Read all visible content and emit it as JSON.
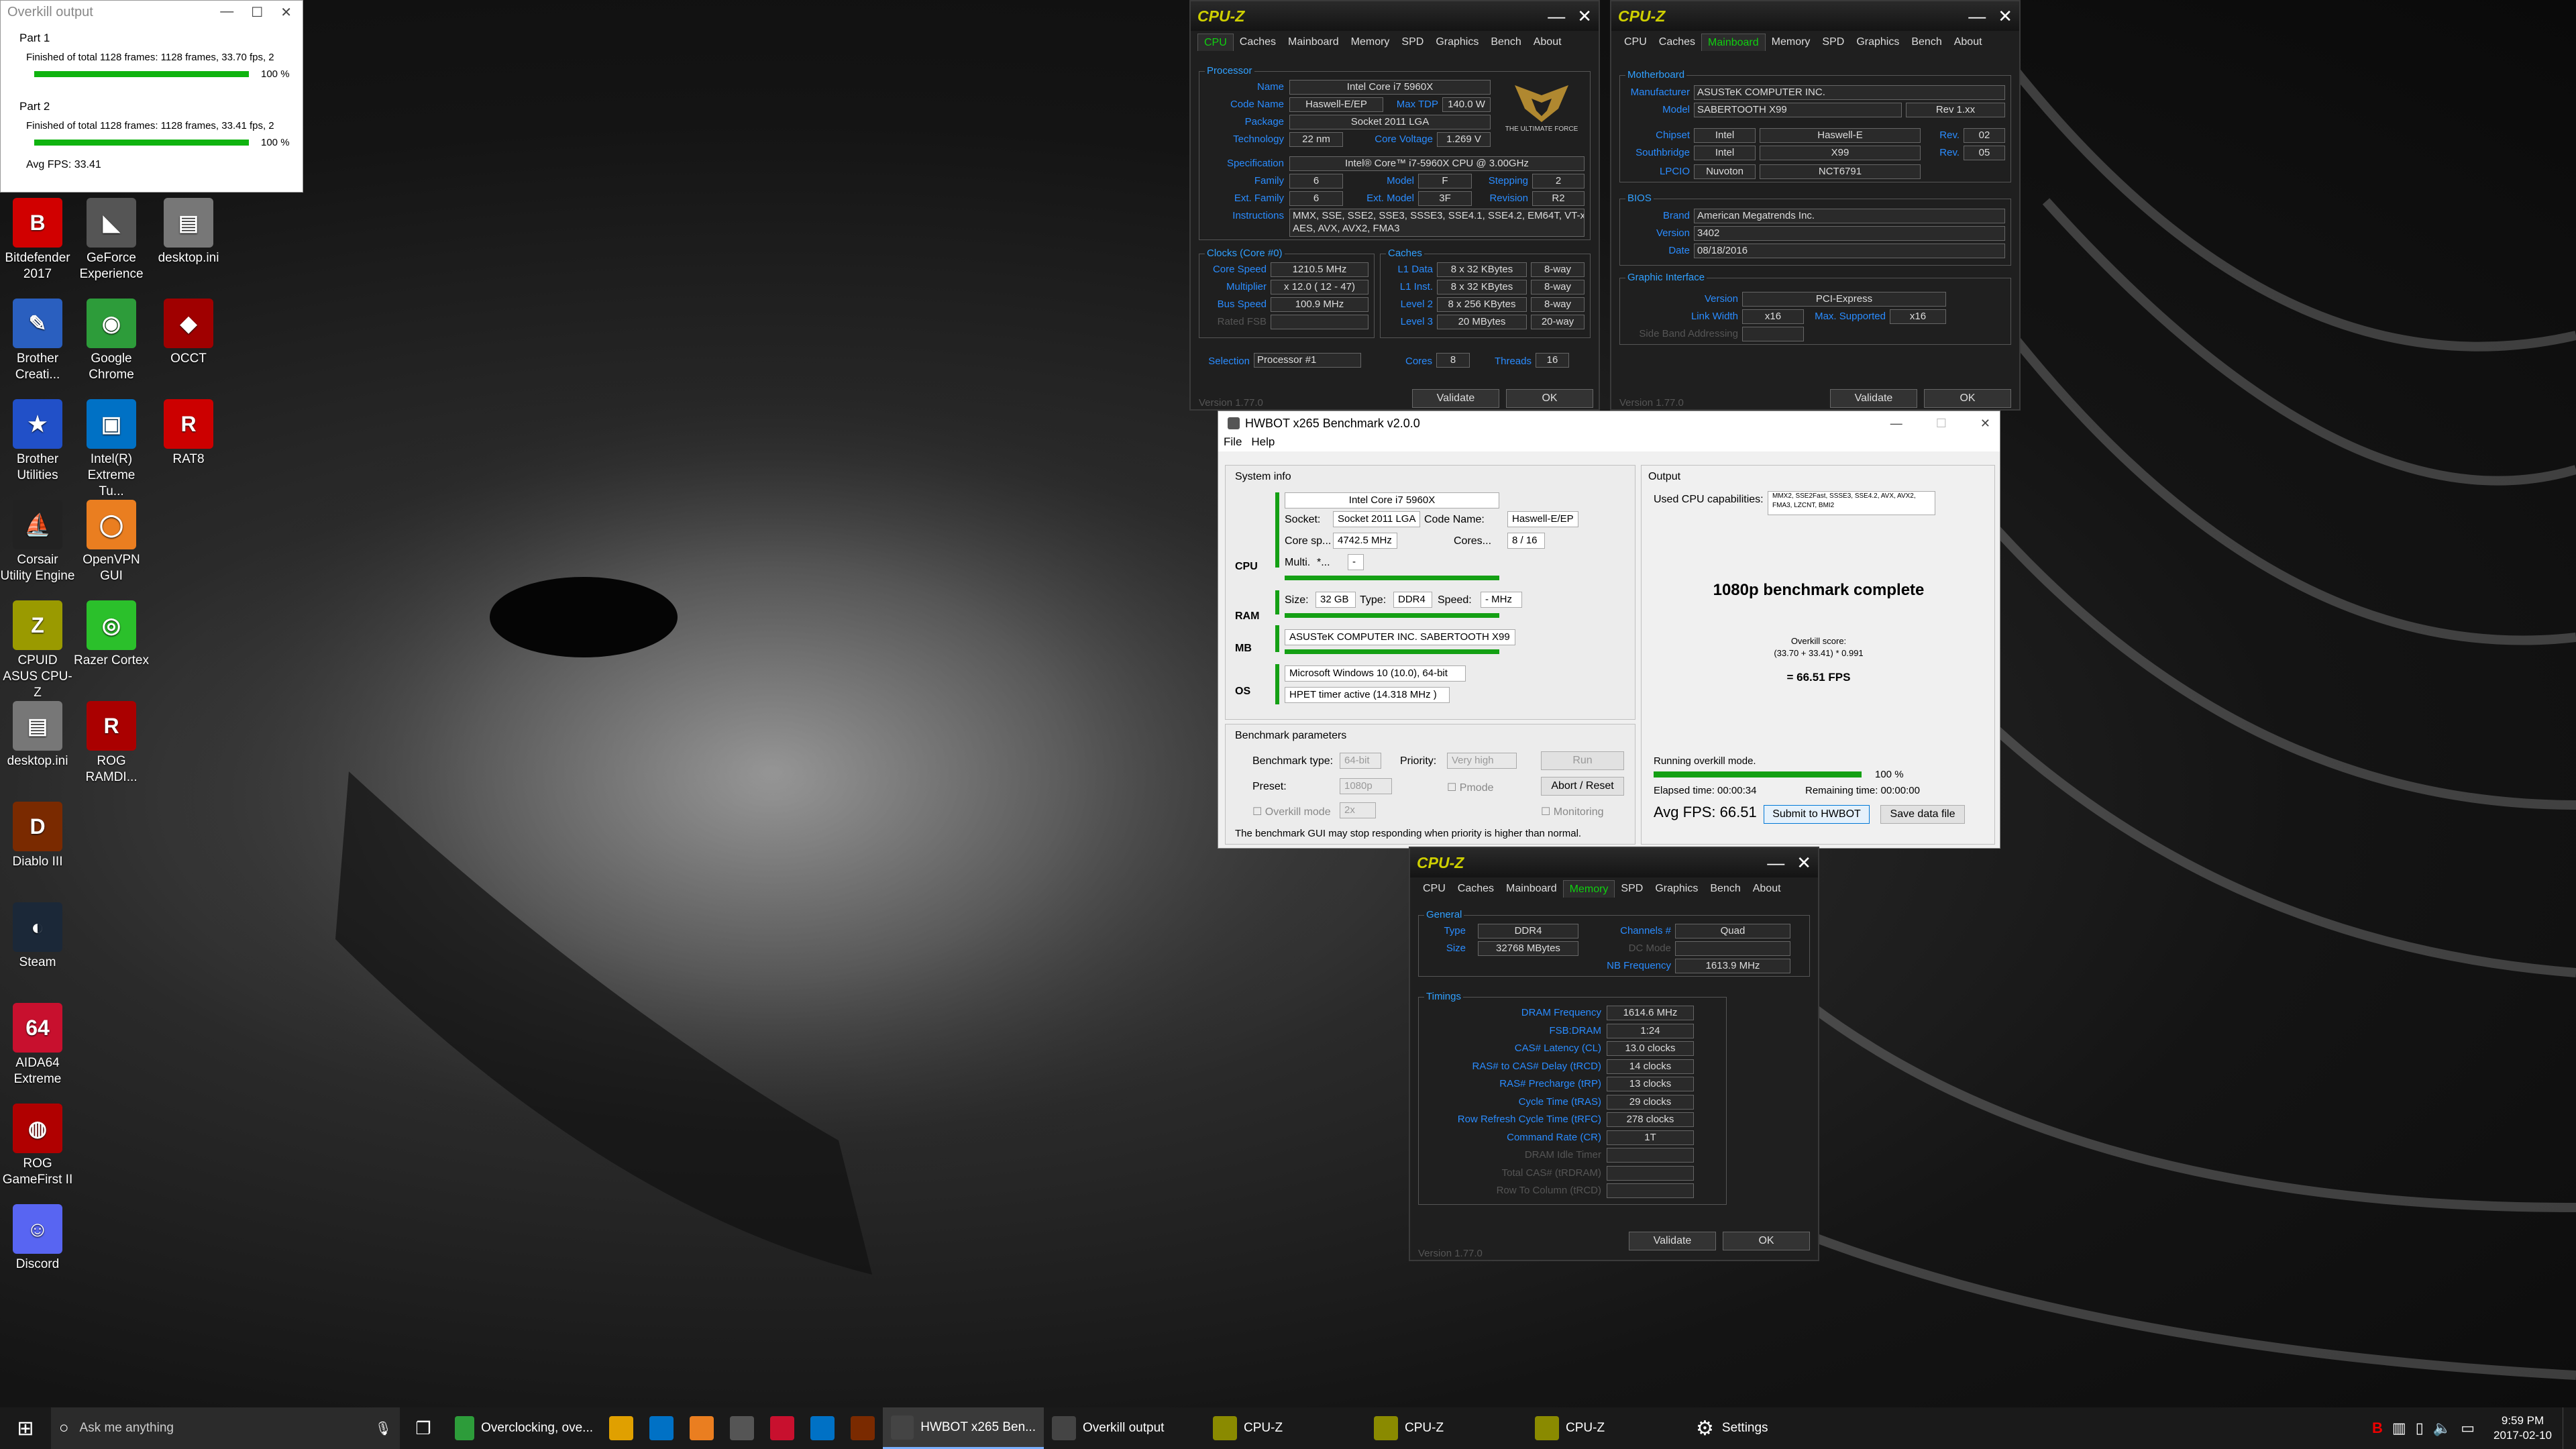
{
  "desktop_icons": [
    {
      "label": "Bitdefender 2017",
      "glyph": "B",
      "color": "#d10000"
    },
    {
      "label": "GeForce Experience",
      "glyph": "◣",
      "color": "#555"
    },
    {
      "label": "desktop.ini",
      "glyph": "▤",
      "color": "#777"
    },
    {
      "label": "Brother Creati...",
      "glyph": "✎",
      "color": "#2a5fbf"
    },
    {
      "label": "Google Chrome",
      "glyph": "◉",
      "color": "#2d9c3a"
    },
    {
      "label": "OCCT",
      "glyph": "◆",
      "color": "#a00000"
    },
    {
      "label": "Brother Utilities",
      "glyph": "★",
      "color": "#2150c8"
    },
    {
      "label": "Intel(R) Extreme Tu...",
      "glyph": "▣",
      "color": "#0071c5"
    },
    {
      "label": "RAT8",
      "glyph": "R",
      "color": "#c00"
    },
    {
      "label": "Corsair Utility Engine",
      "glyph": "⛵",
      "color": "#222"
    },
    {
      "label": "OpenVPN GUI",
      "glyph": "◯",
      "color": "#ea7e20"
    },
    {
      "label": "CPUID ASUS CPU-Z",
      "glyph": "Z",
      "color": "#9a9a00"
    },
    {
      "label": "Razer Cortex",
      "glyph": "◎",
      "color": "#2bc02b"
    },
    {
      "label": "desktop.ini",
      "glyph": "▤",
      "color": "#777"
    },
    {
      "label": "ROG RAMDI...",
      "glyph": "R",
      "color": "#aa0000"
    },
    {
      "label": "Diablo III",
      "glyph": "D",
      "color": "#7a2a00"
    },
    {
      "label": "Steam",
      "glyph": "◐",
      "color": "#1b2838"
    },
    {
      "label": "AIDA64 Extreme",
      "glyph": "64",
      "color": "#c8102e"
    },
    {
      "label": "ROG GameFirst II",
      "glyph": "◍",
      "color": "#b00000"
    },
    {
      "label": "Discord",
      "glyph": "☺",
      "color": "#5865f2"
    }
  ],
  "overkill": {
    "title": "Overkill output",
    "part1_label": "Part 1",
    "part1_text": "Finished of total 1128 frames: 1128 frames, 33.70 fps,  2",
    "part1_pct": "100 %",
    "part1_progress": 1.0,
    "part2_label": "Part 2",
    "part2_text": "Finished of total 1128 frames: 1128 frames, 33.41 fps,  2",
    "part2_pct": "100 %",
    "part2_progress": 1.0,
    "avg": "Avg FPS: 33.41"
  },
  "cpuz_cpu": {
    "title": "CPU-Z",
    "tabs": [
      "CPU",
      "Caches",
      "Mainboard",
      "Memory",
      "SPD",
      "Graphics",
      "Bench",
      "About"
    ],
    "processor_group": "Processor",
    "name_l": "Name",
    "name": "Intel Core i7 5960X",
    "code_l": "Code Name",
    "code": "Haswell-E/EP",
    "tdp_l": "Max TDP",
    "tdp": "140.0 W",
    "pkg_l": "Package",
    "pkg": "Socket 2011 LGA",
    "tech_l": "Technology",
    "tech": "22 nm",
    "volt_l": "Core Voltage",
    "volt": "1.269 V",
    "spec_l": "Specification",
    "spec": "Intel® Core™ i7-5960X CPU @ 3.00GHz",
    "fam_l": "Family",
    "fam": "6",
    "model_l": "Model",
    "model": "F",
    "step_l": "Stepping",
    "step": "2",
    "extfam_l": "Ext. Family",
    "extfam": "6",
    "extmod_l": "Ext. Model",
    "extmod": "3F",
    "rev_l": "Revision",
    "rev": "R2",
    "instr_l": "Instructions",
    "instr1": "MMX, SSE, SSE2, SSE3, SSSE3, SSE4.1, SSE4.2, EM64T, VT-x,",
    "instr2": "AES, AVX, AVX2, FMA3",
    "logo1": "THE ULTIMATE FORCE",
    "clocks_group": "Clocks (Core #0)",
    "caches_group": "Caches",
    "cs_l": "Core Speed",
    "cs": "1210.5 MHz",
    "mul_l": "Multiplier",
    "mul": "x 12.0 ( 12 - 47)",
    "bus_l": "Bus Speed",
    "bus": "100.9 MHz",
    "fsb_l": "Rated FSB",
    "l1d_l": "L1 Data",
    "l1d": "8 x 32 KBytes",
    "l1d_w": "8-way",
    "l1i_l": "L1 Inst.",
    "l1i": "8 x 32 KBytes",
    "l1i_w": "8-way",
    "l2_l": "Level 2",
    "l2": "8 x 256 KBytes",
    "l2_w": "8-way",
    "l3_l": "Level 3",
    "l3": "20 MBytes",
    "l3_w": "20-way",
    "sel_l": "Selection",
    "sel": "Processor #1",
    "cores_l": "Cores",
    "cores": "8",
    "threads_l": "Threads",
    "threads": "16",
    "validate": "Validate",
    "ok": "OK",
    "version": "Version 1.77.0"
  },
  "cpuz_mb": {
    "title": "CPU-Z",
    "tabs": [
      "CPU",
      "Caches",
      "Mainboard",
      "Memory",
      "SPD",
      "Graphics",
      "Bench",
      "About"
    ],
    "mb_group": "Motherboard",
    "manu_l": "Manufacturer",
    "manu": "ASUSTeK COMPUTER INC.",
    "model_l": "Model",
    "model": "SABERTOOTH X99",
    "model_rev": "Rev 1.xx",
    "chip_l": "Chipset",
    "chip_v": "Intel",
    "chip_n": "Haswell-E",
    "chip_rl": "Rev.",
    "chip_r": "02",
    "sb_l": "Southbridge",
    "sb_v": "Intel",
    "sb_n": "X99",
    "sb_rl": "Rev.",
    "sb_r": "05",
    "lpc_l": "LPCIO",
    "lpc_v": "Nuvoton",
    "lpc_n": "NCT6791",
    "bios_group": "BIOS",
    "brand_l": "Brand",
    "brand": "American Megatrends Inc.",
    "ver_l": "Version",
    "ver": "3402",
    "date_l": "Date",
    "date": "08/18/2016",
    "gi_group": "Graphic Interface",
    "giv_l": "Version",
    "giv": "PCI-Express",
    "lw_l": "Link Width",
    "lw": "x16",
    "ms_l": "Max. Supported",
    "ms": "x16",
    "sba_l": "Side Band Addressing",
    "validate": "Validate",
    "ok": "OK",
    "version": "Version 1.77.0"
  },
  "cpuz_mem": {
    "title": "CPU-Z",
    "tabs": [
      "CPU",
      "Caches",
      "Mainboard",
      "Memory",
      "SPD",
      "Graphics",
      "Bench",
      "About"
    ],
    "gen_group": "General",
    "type_l": "Type",
    "type": "DDR4",
    "ch_l": "Channels #",
    "ch": "Quad",
    "size_l": "Size",
    "size": "32768 MBytes",
    "dc_l": "DC Mode",
    "nb_l": "NB Frequency",
    "nb": "1613.9 MHz",
    "tim_group": "Timings",
    "rows": [
      {
        "l": "DRAM Frequency",
        "v": "1614.6 MHz"
      },
      {
        "l": "FSB:DRAM",
        "v": "1:24"
      },
      {
        "l": "CAS# Latency (CL)",
        "v": "13.0 clocks"
      },
      {
        "l": "RAS# to CAS# Delay (tRCD)",
        "v": "14 clocks"
      },
      {
        "l": "RAS# Precharge (tRP)",
        "v": "13 clocks"
      },
      {
        "l": "Cycle Time (tRAS)",
        "v": "29 clocks"
      },
      {
        "l": "Row Refresh Cycle Time (tRFC)",
        "v": "278 clocks"
      },
      {
        "l": "Command Rate (CR)",
        "v": "1T"
      },
      {
        "l": "DRAM Idle Timer",
        "v": ""
      },
      {
        "l": "Total CAS# (tRDRAM)",
        "v": ""
      },
      {
        "l": "Row To Column (tRCD)",
        "v": ""
      }
    ],
    "validate": "Validate",
    "ok": "OK",
    "version": "Version 1.77.0"
  },
  "hwbot": {
    "title": "HWBOT x265 Benchmark v2.0.0",
    "menu_file": "File",
    "menu_help": "Help",
    "sysinfo": "System info",
    "cpu_name": "Intel Core i7 5960X",
    "socket_l": "Socket:",
    "socket": "Socket 2011 LGA",
    "code_l": "Code Name:",
    "code": "Haswell-E/EP",
    "coresp_l": "Core sp...",
    "coresp": "4742.5 MHz",
    "cores_l": "Cores...",
    "cores": "8 / 16",
    "multi_l": "Multi.",
    "multi": "*...",
    "multi2": "-",
    "cpu_tag": "CPU",
    "ram_tag": "RAM",
    "mb_tag": "MB",
    "os_tag": "OS",
    "size_l": "Size:",
    "size": "32 GB",
    "type_l": "Type:",
    "type": "DDR4",
    "speed_l": "Speed:",
    "speed": "- MHz",
    "mb": "ASUSTeK COMPUTER INC. SABERTOOTH X99",
    "os": "Microsoft Windows 10 (10.0), 64-bit",
    "timer": "HPET timer active (14.318 MHz )",
    "params": "Benchmark parameters",
    "btype_l": "Benchmark type:",
    "btype": "64-bit",
    "prio_l": "Priority:",
    "prio": "Very high",
    "run": "Run",
    "preset_l": "Preset:",
    "preset": "1080p",
    "pmode": "Pmode",
    "abort": "Abort / Reset",
    "overkill_l": "Overkill mode",
    "overkill": "2x",
    "monitoring": "Monitoring",
    "warning": "The benchmark GUI may stop responding when priority is higher than normal.",
    "output": "Output",
    "caps_l": "Used CPU capabilities:",
    "caps": "MMX2, SSE2Fast, SSSE3, SSE4.2, AVX, AVX2, FMA3, LZCNT, BMI2",
    "complete": "1080p benchmark complete",
    "score_l": "Overkill score:",
    "score_f": "(33.70 + 33.41) * 0.991",
    "score": "= 66.51 FPS",
    "running": "Running overkill mode.",
    "pct": "100 %",
    "progress": 1.0,
    "elapsed": "Elapsed time: 00:00:34",
    "remaining": "Remaining time: 00:00:00",
    "avg": "Avg FPS: 66.51",
    "submit": "Submit to HWBOT",
    "save": "Save data file"
  },
  "taskbar": {
    "search": "Ask me anything",
    "items": [
      {
        "label": "Overclocking, ove...",
        "color": "#2d9c3a"
      },
      {
        "label": "",
        "color": "#e0a000"
      },
      {
        "label": "",
        "color": "#0071c5"
      },
      {
        "label": "",
        "color": "#ea7e20"
      },
      {
        "label": "",
        "color": "#555"
      },
      {
        "label": "",
        "color": "#c8102e"
      },
      {
        "label": "",
        "color": "#0071c5"
      },
      {
        "label": "",
        "color": "#7a2a00"
      }
    ],
    "windows": [
      {
        "label": "HWBOT x265 Ben...",
        "active": true
      },
      {
        "label": "Overkill output",
        "active": false
      },
      {
        "label": "CPU-Z",
        "active": false
      },
      {
        "label": "CPU-Z",
        "active": false
      },
      {
        "label": "CPU-Z",
        "active": false
      }
    ],
    "settings": "Settings",
    "time": "9:59 PM",
    "date": "2017-02-10"
  }
}
